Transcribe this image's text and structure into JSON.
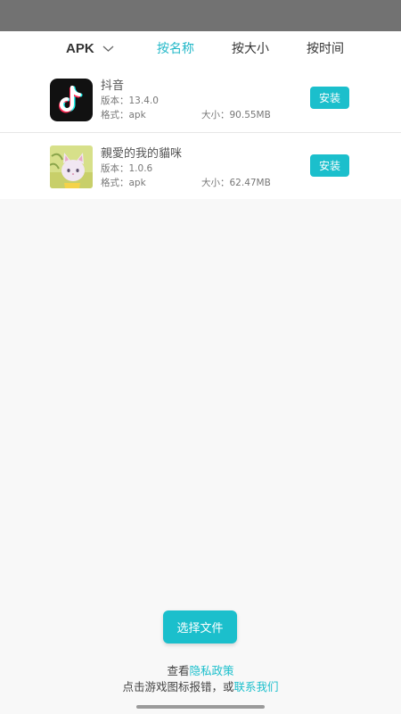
{
  "header": {
    "filter_label": "APK",
    "tabs": [
      {
        "label": "按名称",
        "active": true
      },
      {
        "label": "按大小",
        "active": false
      },
      {
        "label": "按时间",
        "active": false
      }
    ]
  },
  "apps": [
    {
      "name": "抖音",
      "version": "版本：13.4.0",
      "format": "格式：apk",
      "size": "大小：90.55MB",
      "install_label": "安装",
      "icon": "tiktok-icon"
    },
    {
      "name": "親愛的我的貓咪",
      "version": "版本：1.0.6",
      "format": "格式：apk",
      "size": "大小：62.47MB",
      "install_label": "安装",
      "icon": "cat-game-icon"
    }
  ],
  "select_file_label": "选择文件",
  "footer": {
    "line1_prefix": "查看",
    "privacy_link": "隐私政策",
    "line2_prefix": "点击游戏图标报错，或",
    "contact_link": "联系我们"
  },
  "colors": {
    "accent": "#1bbfcc",
    "status_bar": "#727272",
    "background": "#f8f8f8"
  }
}
